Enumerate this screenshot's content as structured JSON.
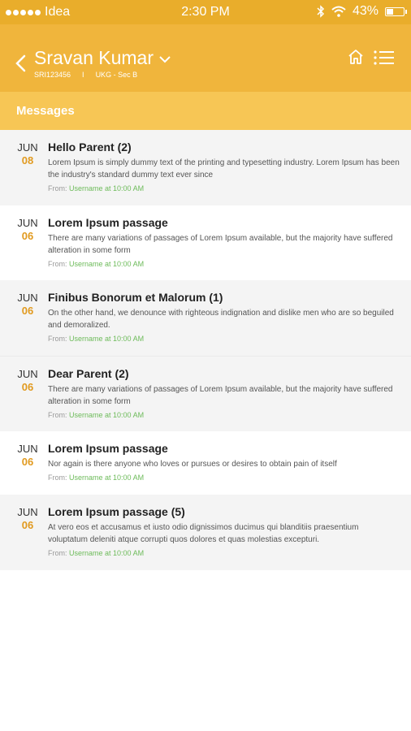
{
  "status": {
    "carrier": "Idea",
    "time": "2:30 PM",
    "battery_pct_text": "43%",
    "battery_level": 0.43
  },
  "header": {
    "name": "Sravan Kumar",
    "id": "SRI123456",
    "separator": "I",
    "class": "UKG - Sec B"
  },
  "section": {
    "title": "Messages"
  },
  "from_label": "From:",
  "messages": [
    {
      "month": "JUN",
      "day": "08",
      "title": "Hello Parent (2)",
      "text": "Lorem Ipsum is simply dummy text of the printing and typesetting industry. Lorem Ipsum has been the industry's standard dummy text ever since",
      "sender": "Username at 10:00 AM"
    },
    {
      "month": "JUN",
      "day": "06",
      "title": "Lorem Ipsum passage",
      "text": "There are many variations of passages of Lorem Ipsum available, but the majority have suffered alteration in some form",
      "sender": "Username at 10:00 AM"
    },
    {
      "month": "JUN",
      "day": "06",
      "title": "Finibus Bonorum et Malorum (1)",
      "text": "On the other hand, we denounce with righteous indignation and dislike men who are so beguiled and demoralized.",
      "sender": "Username at 10:00 AM"
    },
    {
      "month": "JUN",
      "day": "06",
      "title": "Dear Parent (2)",
      "text": "There are many variations of passages of Lorem Ipsum available, but the majority have suffered alteration in some form",
      "sender": "Username at 10:00 AM"
    },
    {
      "month": "JUN",
      "day": "06",
      "title": "Lorem Ipsum passage",
      "text": "Nor again is there anyone who loves or pursues or desires to obtain pain of itself",
      "sender": "Username at 10:00 AM"
    },
    {
      "month": "JUN",
      "day": "06",
      "title": "Lorem Ipsum passage (5)",
      "text": "At vero eos et accusamus et iusto odio dignissimos ducimus qui blanditiis praesentium voluptatum deleniti atque corrupti quos dolores et quas molestias excepturi.",
      "sender": "Username at 10:00 AM"
    }
  ],
  "icons": {
    "back": "chevron-left-icon",
    "dropdown": "chevron-down-icon",
    "home": "home-icon",
    "menu": "list-menu-icon",
    "bluetooth": "bluetooth-icon",
    "wifi": "wifi-icon",
    "battery": "battery-icon"
  },
  "colors": {
    "status_bar": "#e9ad2b",
    "header": "#f0b53c",
    "section_bar": "#f7c655",
    "day_accent": "#e19a1f",
    "username": "#6dbb5a"
  }
}
